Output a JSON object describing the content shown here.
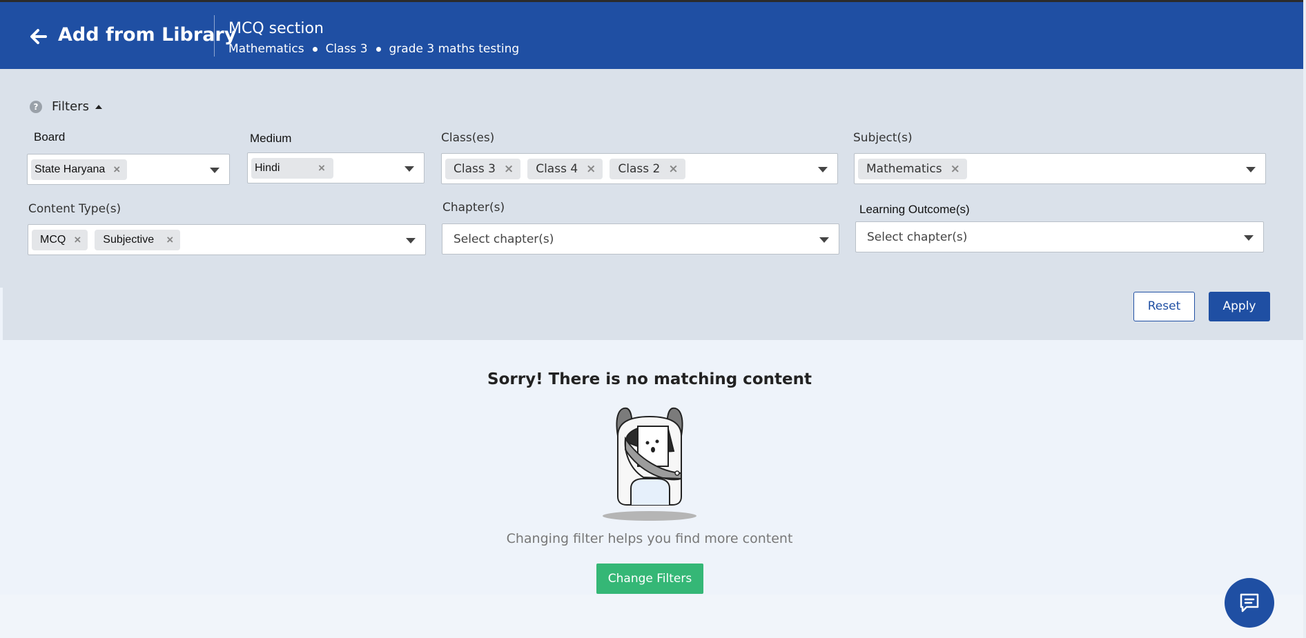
{
  "header": {
    "title": "Add from Library",
    "section": "MCQ section",
    "breadcrumbs": [
      "Mathematics",
      "Class 3",
      "grade 3 maths testing"
    ]
  },
  "filters": {
    "toggle_label": "Filters",
    "board": {
      "label": "Board",
      "chips": [
        "State Haryana"
      ]
    },
    "medium": {
      "label": "Medium",
      "chips": [
        "Hindi"
      ]
    },
    "classes": {
      "label": "Class(es)",
      "chips": [
        "Class 3",
        "Class 4",
        "Class 2"
      ]
    },
    "subjects": {
      "label": "Subject(s)",
      "chips": [
        "Mathematics"
      ]
    },
    "content_types": {
      "label": "Content Type(s)",
      "chips": [
        "MCQ",
        "Subjective"
      ]
    },
    "chapters": {
      "label": "Chapter(s)",
      "placeholder": "Select chapter(s)"
    },
    "learning_outcomes": {
      "label": "Learning Outcome(s)",
      "placeholder": "Select chapter(s)"
    },
    "reset_label": "Reset",
    "apply_label": "Apply"
  },
  "empty_state": {
    "title": "Sorry! There is no matching content",
    "subtitle": "Changing filter helps you find more content",
    "button_label": "Change Filters"
  },
  "colors": {
    "primary": "#1f4fa3",
    "filter_panel": "#dae1ea",
    "success": "#35b776"
  }
}
